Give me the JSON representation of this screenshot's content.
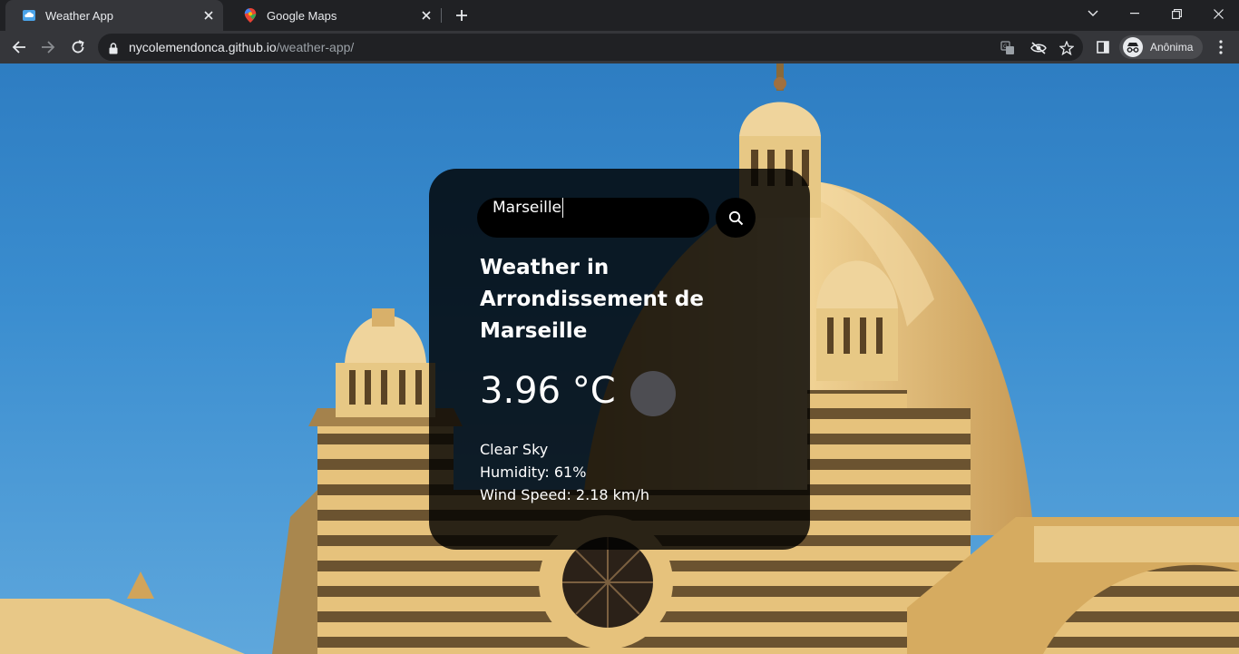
{
  "browser": {
    "tabs": [
      {
        "title": "Weather App",
        "active": true,
        "favicon": "weather-favicon"
      },
      {
        "title": "Google Maps",
        "active": false,
        "favicon": "maps-pin-favicon"
      }
    ],
    "url_host": "nycolemendonca.github.io",
    "url_path": "/weather-app/",
    "profile_label": "Anônima"
  },
  "weather": {
    "search_value": "Marseille",
    "city_title": "Weather in Arrondissement de Marseille",
    "temperature": "3.96 °C",
    "description": "Clear Sky",
    "humidity": "Humidity: 61%",
    "wind": "Wind Speed: 2.18 km/h"
  },
  "colors": {
    "chrome_dark": "#202124",
    "chrome_toolbar": "#35363a",
    "sky": "#3a8dcf",
    "card_bg": "rgba(0,0,0,0.82)",
    "stone": "#e4c07a"
  }
}
